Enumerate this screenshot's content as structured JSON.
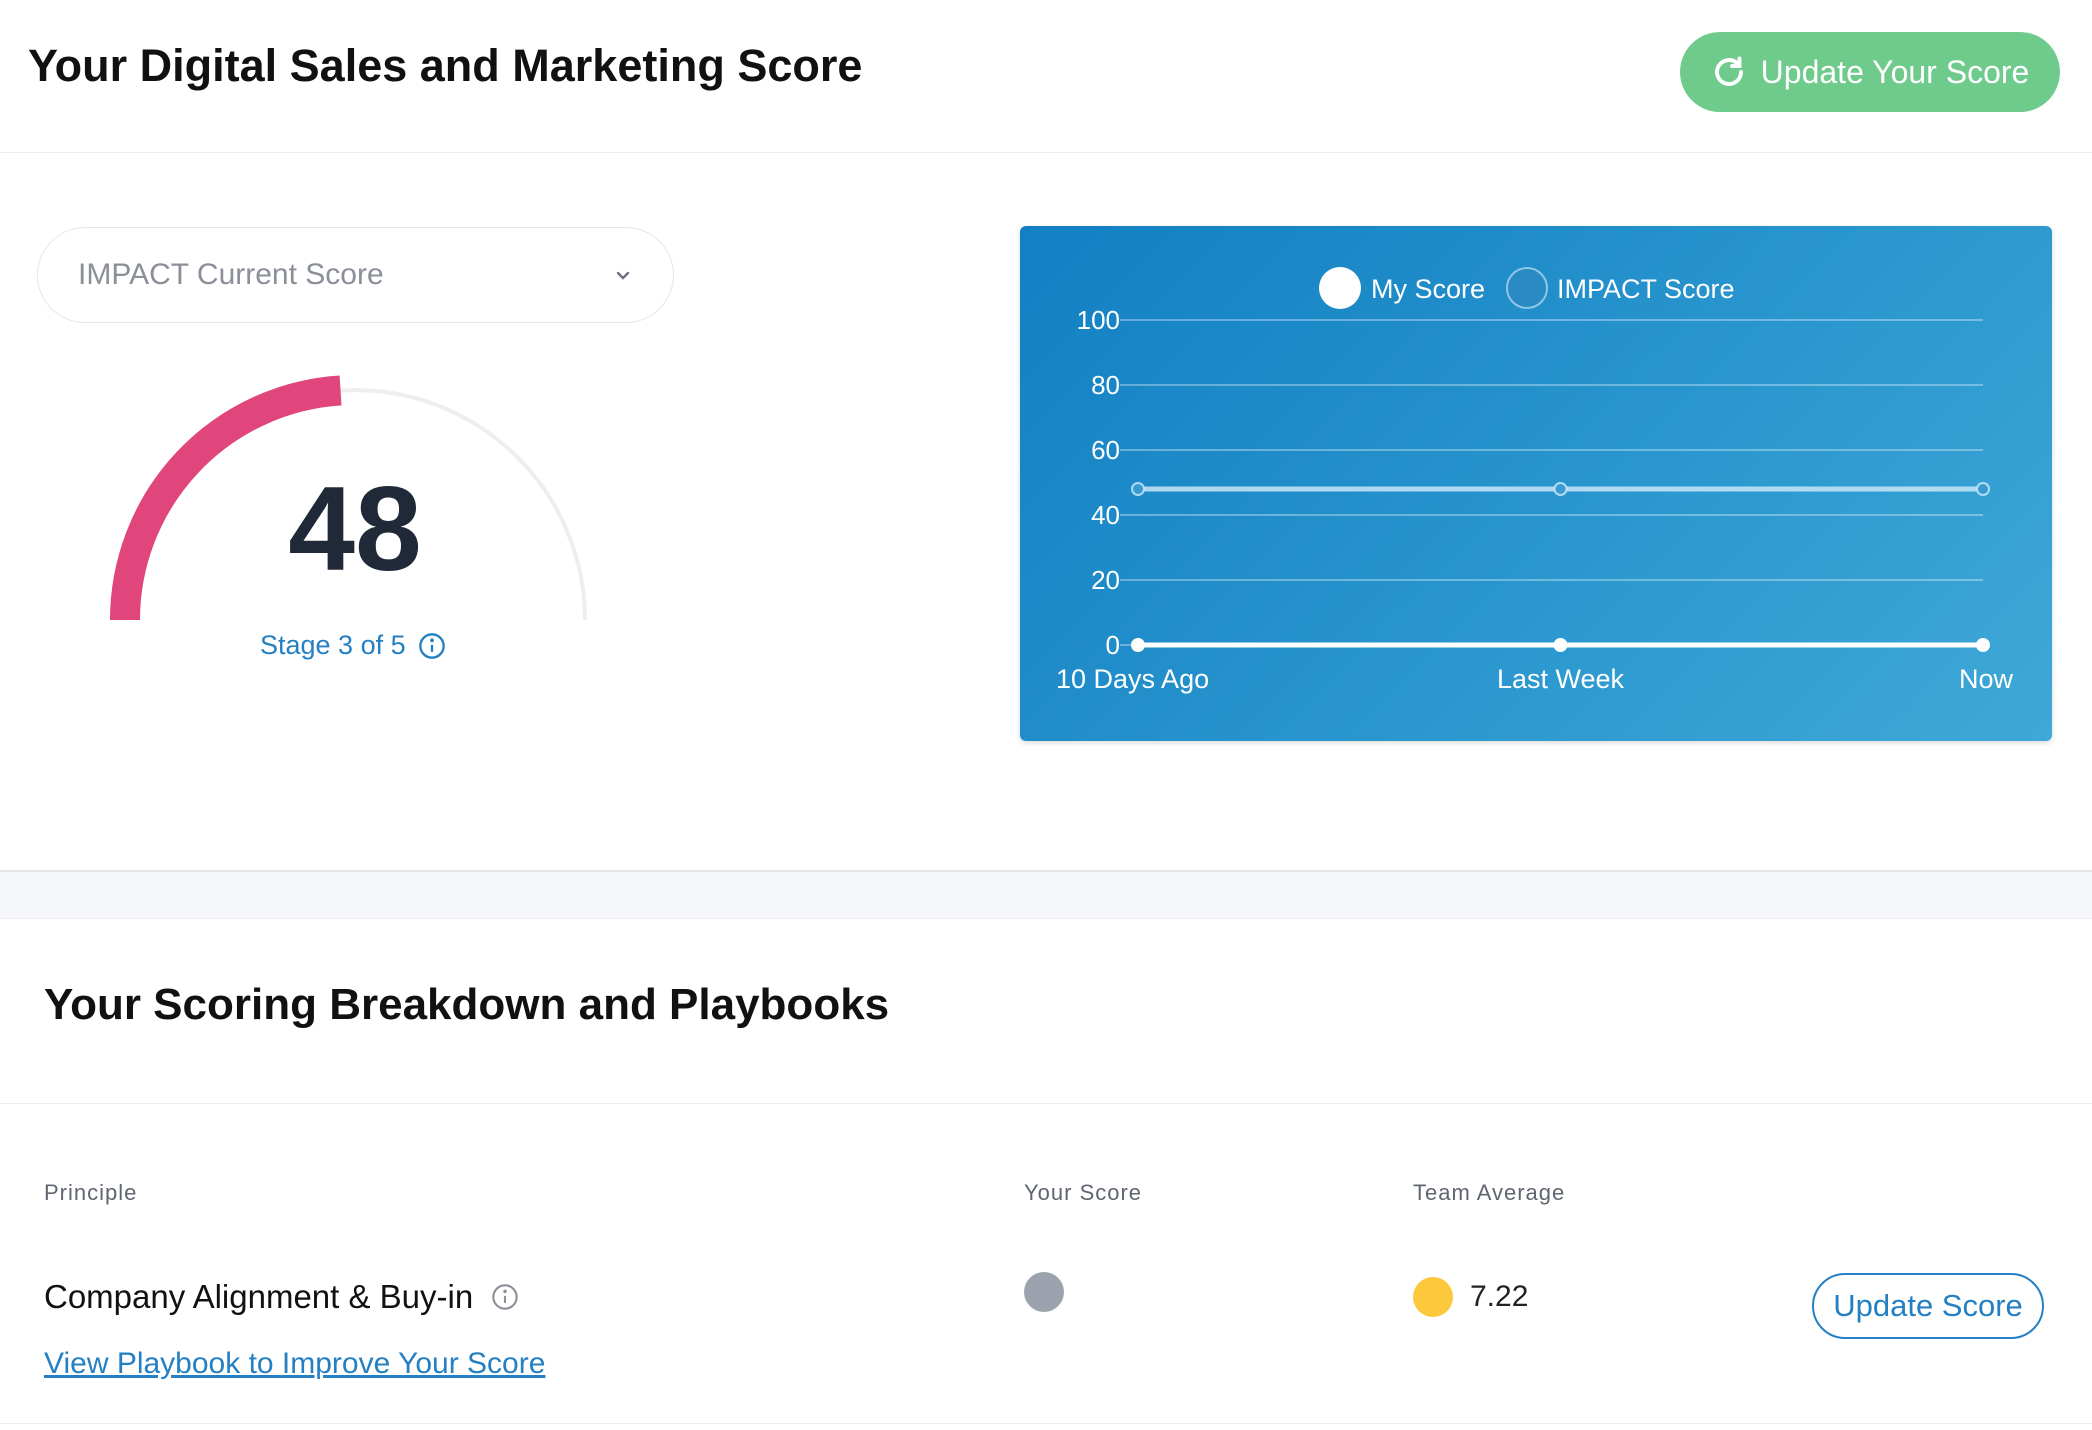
{
  "header": {
    "title": "Your Digital Sales and Marketing Score",
    "update_button": "Update Your Score"
  },
  "score_panel": {
    "select_value": "IMPACT Current Score",
    "score": "48",
    "gauge_fraction": 0.48,
    "stage": "Stage 3 of 5",
    "gauge_color": "#e0457b"
  },
  "chart_data": {
    "type": "line",
    "legend": [
      "My Score",
      "IMPACT Score"
    ],
    "categories": [
      "10 Days Ago",
      "Last Week",
      "Now"
    ],
    "series": [
      {
        "name": "My Score",
        "values": [
          0,
          0,
          0
        ]
      },
      {
        "name": "IMPACT Score",
        "values": [
          48,
          48,
          48
        ]
      }
    ],
    "yticks": [
      "100",
      "80",
      "60",
      "40",
      "20",
      "0"
    ],
    "ylim": [
      0,
      100
    ],
    "grid": true,
    "legend_position": "top-center"
  },
  "breakdown": {
    "title": "Your Scoring Breakdown and Playbooks",
    "columns": {
      "principle": "Principle",
      "your_score": "Your Score",
      "team_average": "Team Average"
    },
    "rows": [
      {
        "principle": "Company Alignment & Buy-in",
        "link": "View Playbook to Improve Your Score",
        "team_average": "7.22",
        "button": "Update Score"
      }
    ]
  }
}
